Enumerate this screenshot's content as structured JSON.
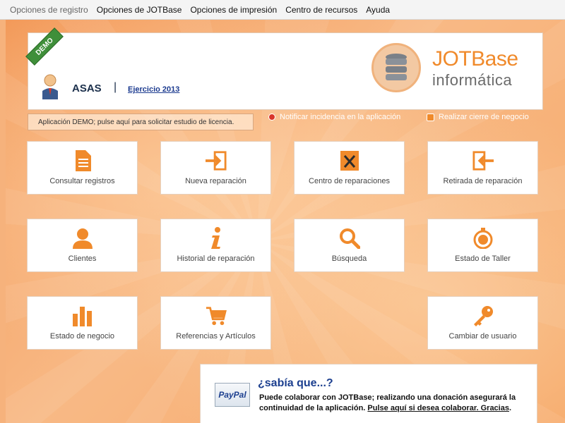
{
  "menu": {
    "items": [
      "Opciones de registro",
      "Opciones de JOTBase",
      "Opciones de impresión",
      "Centro de recursos",
      "Ayuda"
    ]
  },
  "header": {
    "ribbon": "DEMO",
    "company": "ASAS",
    "separator": "|",
    "ejercicio": "Ejercicio 2013",
    "logo_title": "JOTBase",
    "logo_sub": "informática"
  },
  "notice": "Aplicación DEMO; pulse aquí para solicitar estudio de licencia.",
  "links": {
    "report": "Notificar incidencia en la aplicación",
    "close_business": "Realizar cierre de negocio"
  },
  "tiles": {
    "consultar": "Consultar registros",
    "nueva": "Nueva reparación",
    "centro": "Centro de reparaciones",
    "retirada": "Retirada de reparación",
    "clientes": "Clientes",
    "historial": "Historial de reparación",
    "busqueda": "Búsqueda",
    "estado_taller": "Estado de Taller",
    "estado_negocio": "Estado de negocio",
    "referencias": "Referencias y Artículos",
    "cambiar": "Cambiar de usuario"
  },
  "paypal": {
    "logo": "PayPal",
    "title": "¿sabía que...?",
    "text": "Puede colaborar con JOTBase; realizando una donación asegurará la continuidad de la aplicación. ",
    "link": "Pulse aquí si desea colaborar. Gracias",
    "tail": "."
  },
  "colors": {
    "accent": "#f08a2b",
    "background": "#f6b27c",
    "navy": "#1b2f4b"
  }
}
